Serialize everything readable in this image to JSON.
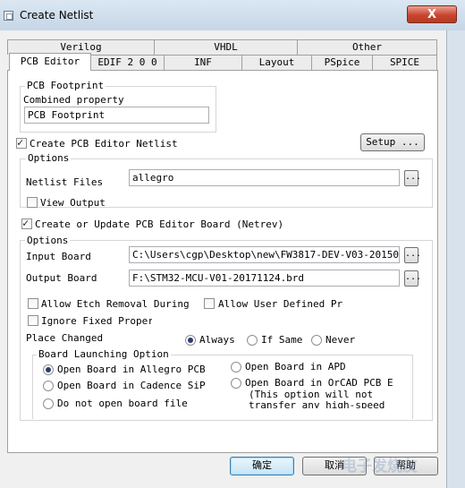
{
  "window": {
    "title": "Create Netlist",
    "close_label": "X"
  },
  "tabs_back": [
    "Verilog",
    "VHDL",
    "Other"
  ],
  "tabs_front": [
    "PCB Editor",
    "EDIF 2 0 0",
    "INF",
    "Layout",
    "PSpice",
    "SPICE"
  ],
  "footprint": {
    "group_label": "PCB Footprint",
    "combined_label": "Combined property",
    "combined_value": "PCB Footprint"
  },
  "netlist": {
    "create_label": "Create PCB Editor Netlist",
    "create_checked": true,
    "setup_label": "Setup ...",
    "options_label": "Options",
    "files_label": "Netlist Files",
    "files_value": "allegro",
    "browse_label": "...",
    "view_output_label": "View Output",
    "view_output_checked": false
  },
  "board": {
    "create_label": "Create or Update PCB Editor Board (Netrev)",
    "create_checked": true,
    "options_label": "Options",
    "input_label": "Input Board",
    "input_value": "C:\\Users\\cgp\\Desktop\\new\\FW3817-DEV-V03-20150606.b",
    "output_label": "Output Board",
    "output_value": "F:\\STM32-MCU-V01-20171124.brd",
    "allow_etch_label": "Allow Etch Removal During E",
    "allow_user_label": "Allow User Defined Prop",
    "ignore_fixed_label": "Ignore Fixed Propert",
    "place_changed_label": "Place Changed",
    "place_options": [
      "Always",
      "If Same",
      "Never"
    ],
    "place_selected": "Always"
  },
  "launch": {
    "group_label": "Board Launching Option",
    "opt_allegro": "Open Board in Allegro PCB Ed",
    "opt_sip": "Open Board in Cadence SiP",
    "opt_none": "Do not open board file",
    "opt_apd": "Open Board in APD",
    "opt_orcad": "Open Board in OrCAD PCB Edi",
    "opt_orcad_note1": "(This option will not",
    "opt_orcad_note2": "transfer any high-speed",
    "selected": "opt_allegro"
  },
  "footer": {
    "ok": "确定",
    "cancel": "取消",
    "help": "帮助",
    "watermark": "电子发烧友"
  }
}
